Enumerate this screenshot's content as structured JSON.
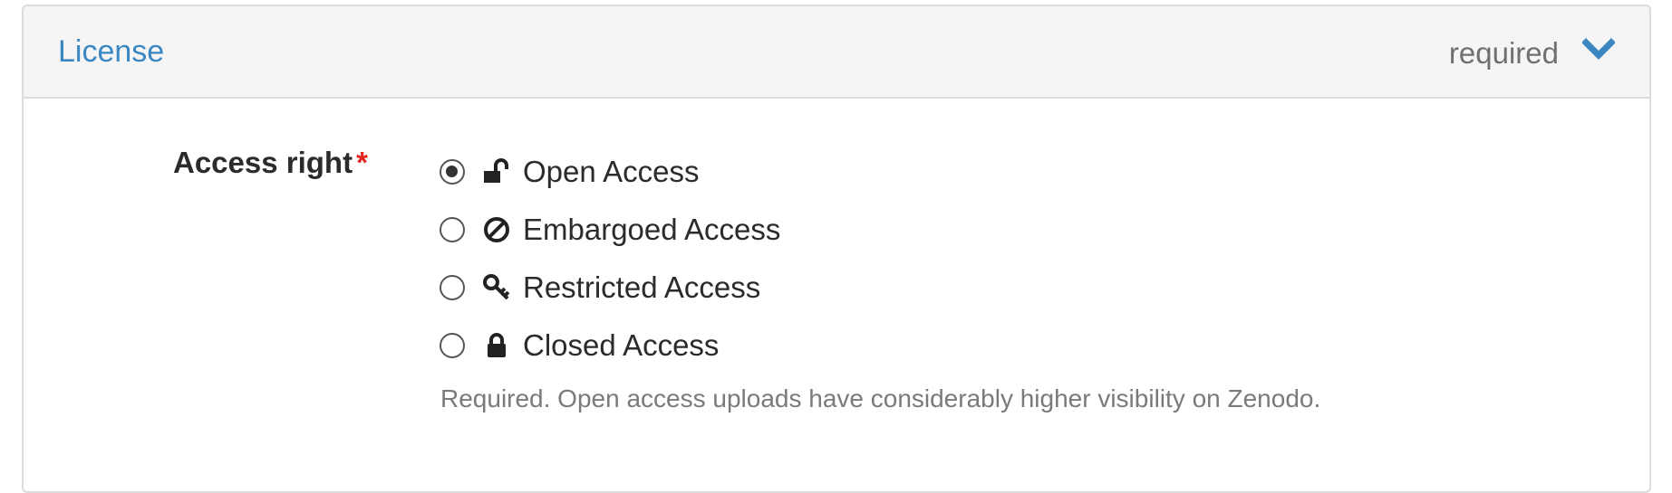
{
  "panel": {
    "title": "License",
    "required_label": "required",
    "toggle_icon": "chevron-down-icon",
    "accent_color": "#3a87c2"
  },
  "access_right": {
    "label": "Access right",
    "required_marker": "*",
    "required_marker_color": "#e0261f",
    "options": [
      {
        "label": "Open Access",
        "icon": "unlock-icon",
        "checked": true
      },
      {
        "label": "Embargoed Access",
        "icon": "ban-icon",
        "checked": false
      },
      {
        "label": "Restricted Access",
        "icon": "key-icon",
        "checked": false
      },
      {
        "label": "Closed Access",
        "icon": "lock-icon",
        "checked": false
      }
    ],
    "help_text": "Required. Open access uploads have considerably higher visibility on Zenodo."
  }
}
